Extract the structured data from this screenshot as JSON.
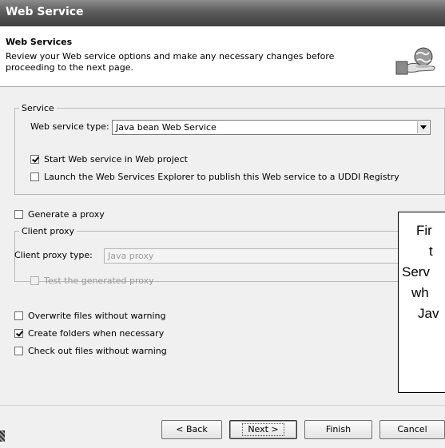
{
  "window": {
    "title": "Web Service"
  },
  "header": {
    "title": "Web Services",
    "description": "Review your Web service options and make any necessary changes before proceeding to the next page."
  },
  "service_group": {
    "legend": "Service",
    "type_label": "Web service type:",
    "type_value": "Java bean Web Service",
    "start_label": "Start Web service in Web project",
    "start_checked": true,
    "launch_label": "Launch the Web Services Explorer to publish this Web service to a UDDI Registry",
    "launch_checked": false
  },
  "generate_proxy": {
    "label": "Generate a proxy",
    "checked": false
  },
  "client_proxy": {
    "legend": "Client proxy",
    "type_label": "Client proxy type:",
    "type_value": "Java proxy",
    "test_label": "Test the generated proxy",
    "test_checked": false
  },
  "options": {
    "overwrite": {
      "label": "Overwrite files without warning",
      "checked": false
    },
    "create_folders": {
      "label": "Create folders when necessary",
      "checked": true
    },
    "checkout": {
      "label": "Check out files without warning",
      "checked": false
    }
  },
  "callout": {
    "lines": [
      "Fir",
      "t",
      "Serv",
      "wh",
      "Jav"
    ]
  },
  "buttons": {
    "back": "< Back",
    "next": "Next >",
    "finish": "Finish",
    "cancel": "Cancel"
  },
  "icons": {
    "banner": "globe-on-hand-icon"
  }
}
